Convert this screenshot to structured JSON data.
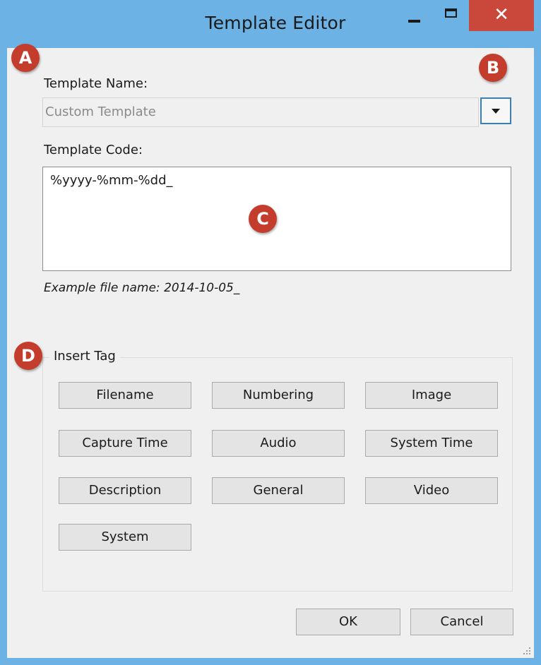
{
  "window": {
    "title": "Template Editor",
    "minimize_icon": "minimize-icon",
    "maximize_icon": "maximize-icon",
    "close_glyph": "✕"
  },
  "template_name": {
    "label": "Template Name:",
    "value": "Custom Template",
    "dropdown_icon": "chevron-down-icon"
  },
  "template_code": {
    "label": "Template Code:",
    "value": "%yyyy-%mm-%dd_",
    "example": "Example file name: 2014-10-05_"
  },
  "insert_tag": {
    "title": "Insert Tag",
    "buttons": [
      "Filename",
      "Numbering",
      "Image",
      "Capture Time",
      "Audio",
      "System Time",
      "Description",
      "General",
      "Video",
      "System"
    ]
  },
  "footer": {
    "ok_label": "OK",
    "cancel_label": "Cancel"
  },
  "callouts": [
    "A",
    "B",
    "C",
    "D"
  ],
  "colors": {
    "titlebar": "#6cb2e4",
    "close_button": "#c9473b",
    "callout_badge": "#c43d2c",
    "focus_border": "#3c7fb1"
  }
}
